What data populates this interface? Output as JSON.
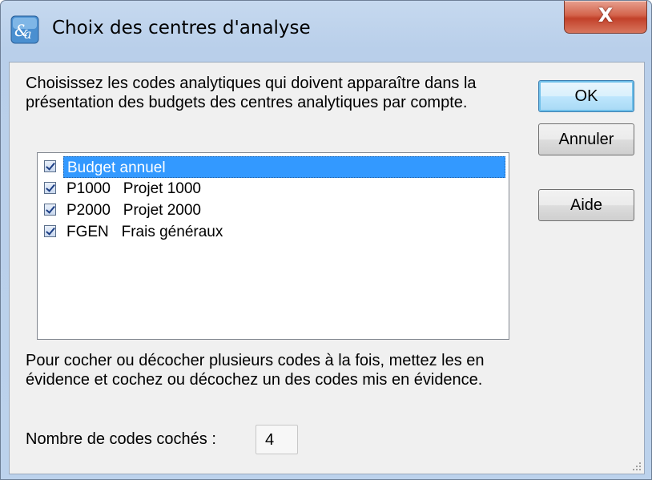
{
  "window": {
    "title": "Choix des centres d'analyse",
    "close_symbol": "X",
    "icon": "app-icon"
  },
  "intro_text": "Choisissez les codes analytiques qui doivent apparaître dans la présentation des budgets des centres analytiques par compte.",
  "list": {
    "items": [
      {
        "label": "Budget annuel",
        "checked": true,
        "selected": true
      },
      {
        "label": "P1000   Projet 1000",
        "checked": true,
        "selected": false
      },
      {
        "label": "P2000   Projet 2000",
        "checked": true,
        "selected": false
      },
      {
        "label": "FGEN   Frais généraux",
        "checked": true,
        "selected": false
      }
    ]
  },
  "help_text": "Pour cocher ou décocher plusieurs codes à la fois, mettez les en évidence et cochez ou décochez un des codes mis en évidence.",
  "count": {
    "label": "Nombre de codes cochés :",
    "value": "4"
  },
  "buttons": {
    "ok": "OK",
    "cancel": "Annuler",
    "help": "Aide"
  },
  "colors": {
    "selection": "#3399ff",
    "close_button": "#c2412a"
  }
}
